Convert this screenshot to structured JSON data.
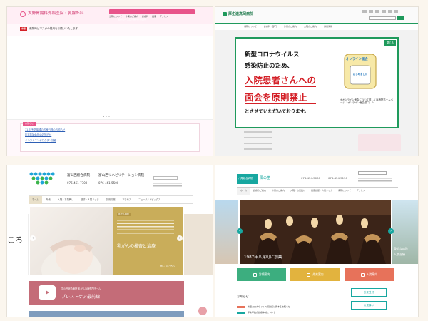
{
  "panel1": {
    "hospital_name": "大野胃腸科外科医院・乳腺外科",
    "header_address": "医療法人 大野胃腸科外科医院",
    "nav": [
      "当院について",
      "外来のご案内",
      "診療科",
      "設備",
      "アクセス"
    ],
    "notice_badge": "重要",
    "notice_text": "来院時はマスクの着用をお願いいたします。",
    "news_label": "お知らせ",
    "news_items": [
      "11月 予防接種の診療日程のお知らせ",
      "年末年始休診のお知らせ",
      "インフルエンザワクチン接種"
    ]
  },
  "panel2": {
    "hospital_name": "厚生連高岡病院",
    "nav": [
      "病院について",
      "診療科・部門",
      "外来のご案内",
      "入院のご案内",
      "採用情報"
    ],
    "popup_close": "閉じる",
    "popup_line1": "新型コロナウイルス",
    "popup_line2": "感染防止のため、",
    "popup_line3": "入院患者さんへの",
    "popup_line4": "面会を原則禁止",
    "popup_line5": "とさせていただいております。",
    "badge_top": "オンライン面会",
    "badge_bottom": "はじめました",
    "note": "※オンライン面会について詳しくは病院ホームページ「オンライン面会窓口」へ"
  },
  "panel3": {
    "hospital1": "富山西総合病院",
    "hospital2": "富山西リハビリテーション病院",
    "phone1": "076-461-7700",
    "phone2": "076-461-5500",
    "nav": [
      "ホーム",
      "外来",
      "入院・お見舞い",
      "健診・人間ドック",
      "採用情報",
      "アクセス",
      "ニュース&トピックス"
    ],
    "feature_tag": "乳がん検診",
    "feature_title": "乳がんの検査と治療",
    "feature_link": "詳しくはこちら",
    "side_text": "ころ",
    "banner_small": "富山西総合病院 乳がん治療専門チーム",
    "banner_title": "ブレストケア最前線"
  },
  "panel4": {
    "hospital_name": "風の笛",
    "hospital_sub": "八尾総合病院",
    "phone1": "076-454-5000",
    "phone2": "076-454-5150",
    "nav": [
      "ホーム",
      "診療のご案内",
      "外来のご案内",
      "入院・お見舞い",
      "健康診断・人間ドック",
      "病院について",
      "アクセス"
    ],
    "hero_caption": "1987年八尾町に創業",
    "side_caption1": "身近な病院",
    "side_caption2": "入院治療",
    "tiles": [
      "診療案内",
      "外来案内",
      "入院案内"
    ],
    "news_label": "お知らせ",
    "news_items": [
      "新型コロナウイルス感染症に関するお知らせ",
      "年末年始の診療体制について"
    ],
    "side_buttons": [
      "外来受付",
      "お見舞い"
    ]
  },
  "colors": {
    "pink": "#e8548a",
    "green": "#1f9a5c",
    "red": "#d42027",
    "teal": "#17a7a0",
    "gold": "#c9ad5a",
    "rose": "#c46c78"
  }
}
